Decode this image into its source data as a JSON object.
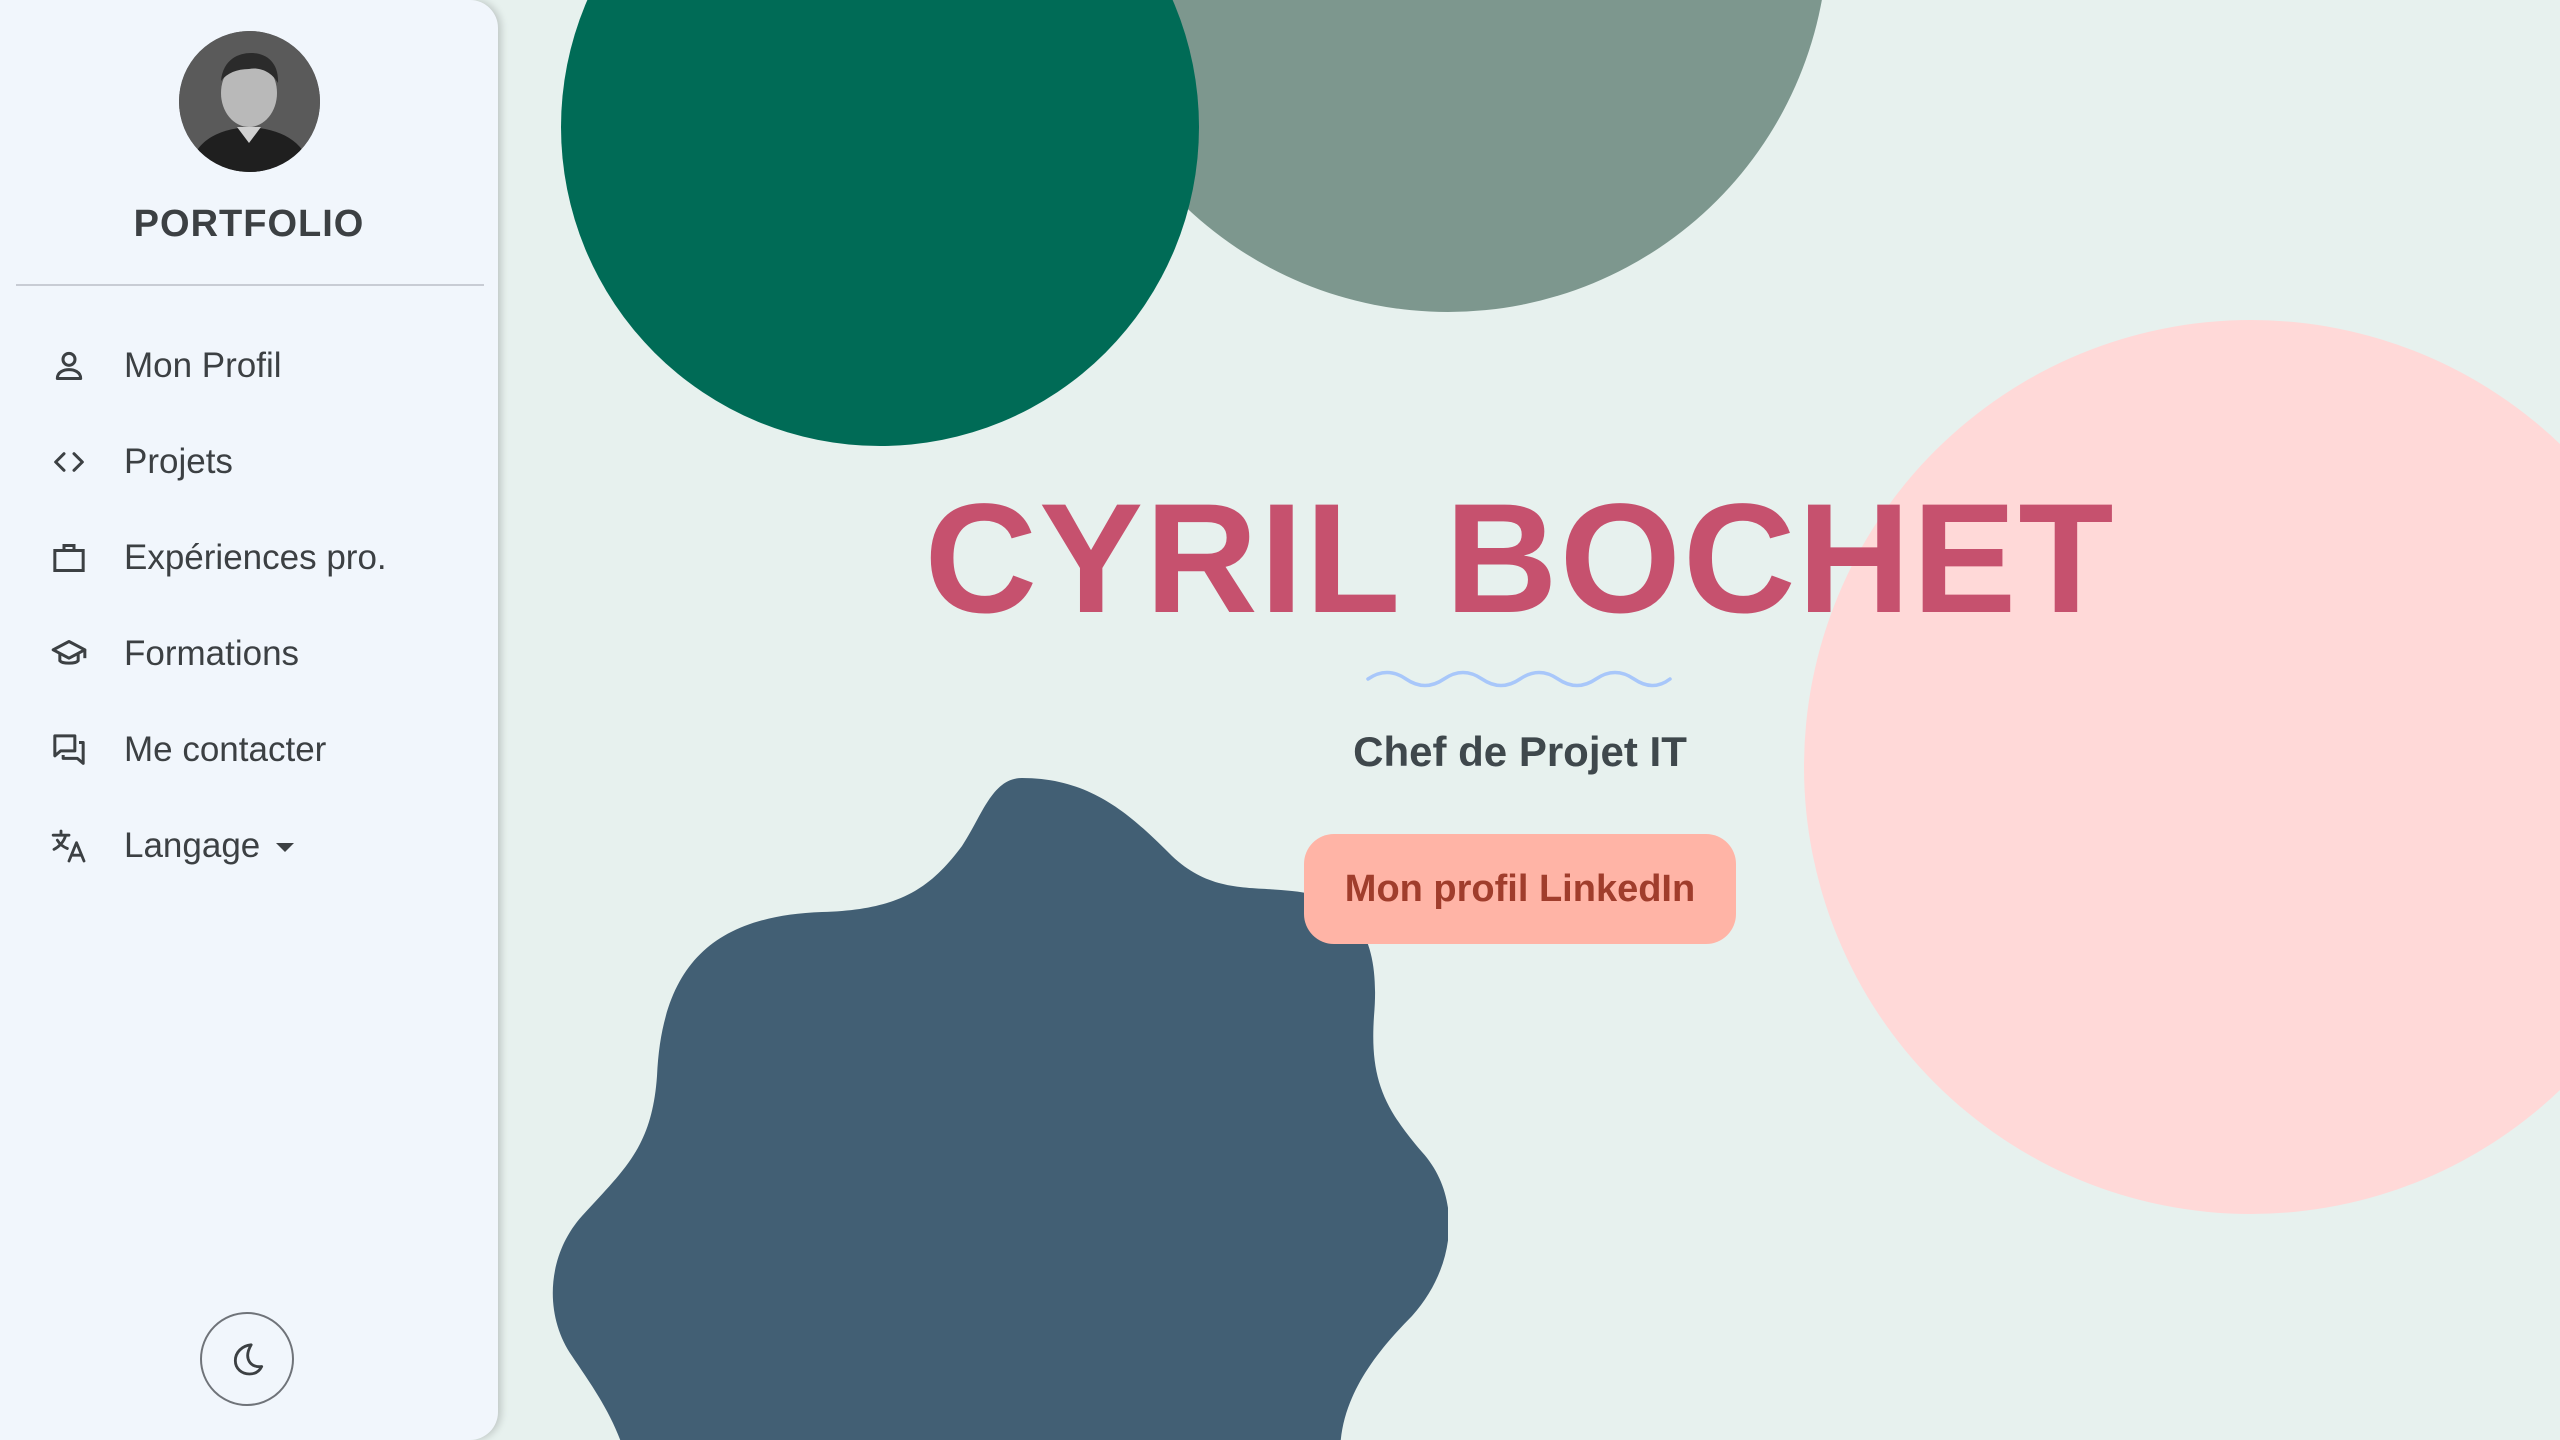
{
  "sidebar": {
    "brand": "PORTFOLIO",
    "avatar_alt": "profile-photo",
    "items": [
      {
        "label": "Mon Profil",
        "icon": "person-icon"
      },
      {
        "label": "Projets",
        "icon": "code-icon"
      },
      {
        "label": "Expériences pro.",
        "icon": "briefcase-icon"
      },
      {
        "label": "Formations",
        "icon": "graduation-cap-icon"
      },
      {
        "label": "Me contacter",
        "icon": "chat-icon"
      },
      {
        "label": "Langage",
        "icon": "translate-icon",
        "has_dropdown": true
      }
    ],
    "theme_toggle_icon": "moon-icon"
  },
  "hero": {
    "name": "CYRIL BOCHET",
    "subtitle": "Chef de Projet IT",
    "cta_label": "Mon profil LinkedIn"
  },
  "colors": {
    "background": "#e7f1ee",
    "sidebar_bg": "#f1f6fc",
    "name_color": "#c6516e",
    "cta_bg": "#ffb4a6",
    "cta_text": "#a03d2c",
    "shape_green": "#006b56",
    "shape_gray": "#7d978e",
    "shape_pink": "#ffd9d8",
    "shape_blob": "#425f74",
    "wave": "#a8c7fa"
  }
}
